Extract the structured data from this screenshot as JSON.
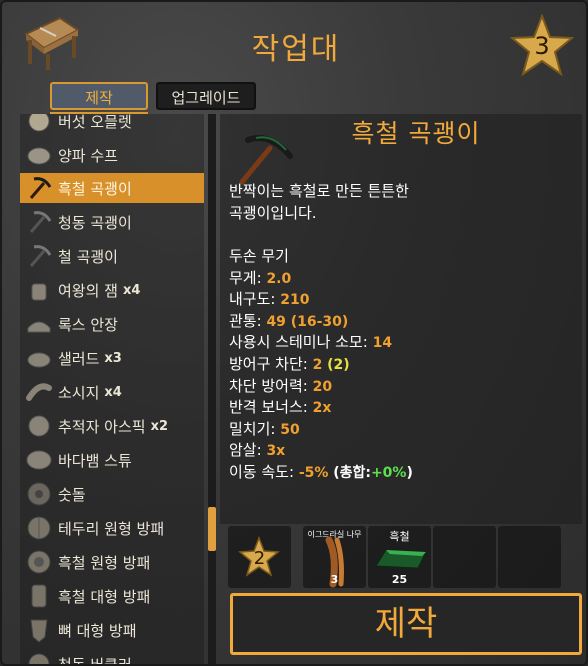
{
  "header": {
    "title": "작업대",
    "station_level": "3"
  },
  "tabs": [
    {
      "label": "제작"
    },
    {
      "label": "업그레이드"
    }
  ],
  "recipes": [
    {
      "label": "버섯 오믈렛",
      "count": ""
    },
    {
      "label": "양파 수프",
      "count": ""
    },
    {
      "label": "흑철 곡괭이",
      "count": ""
    },
    {
      "label": "청동 곡괭이",
      "count": ""
    },
    {
      "label": "철 곡괭이",
      "count": ""
    },
    {
      "label": "여왕의 잼",
      "count": "x4"
    },
    {
      "label": "록스 안장",
      "count": ""
    },
    {
      "label": "샐러드",
      "count": "x3"
    },
    {
      "label": "소시지",
      "count": "x4"
    },
    {
      "label": "추적자 아스픽",
      "count": "x2"
    },
    {
      "label": "바다뱀 스튜",
      "count": ""
    },
    {
      "label": "숫돌",
      "count": ""
    },
    {
      "label": "테두리 원형 방패",
      "count": ""
    },
    {
      "label": "흑철 원형 방패",
      "count": ""
    },
    {
      "label": "흑철 대형 방패",
      "count": ""
    },
    {
      "label": "뼈 대형 방패",
      "count": ""
    },
    {
      "label": "청동 버클러",
      "count": ""
    }
  ],
  "detail": {
    "title": "흑철 곡괭이",
    "desc_line1": "반짝이는 흑철로 만든 튼튼한",
    "desc_line2": "곡괭이입니다.",
    "weapon_type": "두손 무기",
    "stats": {
      "weight_label": "무게:",
      "weight": "2.0",
      "durability_label": "내구도:",
      "durability": "210",
      "pierce_label": "관통:",
      "pierce": "49",
      "pierce_range": "(16-30)",
      "stamina_label": "사용시 스테미나 소모:",
      "stamina": "14",
      "block_label": "방어구 차단:",
      "block": "2",
      "block_extra": "(2)",
      "block_force_label": "차단 방어력:",
      "block_force": "20",
      "parry_label": "반격 보너스:",
      "parry": "2x",
      "knockback_label": "밀치기:",
      "knockback": "50",
      "backstab_label": "암살:",
      "backstab": "3x",
      "move_label": "이동 속도:",
      "move": "-5%",
      "total_open": "(총합:",
      "total": "+0%",
      "total_close": ")"
    }
  },
  "requirements": {
    "quality_level": "2",
    "items": [
      {
        "name": "이그드라실 나무",
        "qty": "3"
      },
      {
        "name": "흑철",
        "qty": "25"
      }
    ]
  },
  "craft_button": "제작",
  "colors": {
    "accent": "#f0a93a",
    "selected": "#d8902a",
    "value": "#f0a030",
    "bonus": "#5ce050"
  }
}
